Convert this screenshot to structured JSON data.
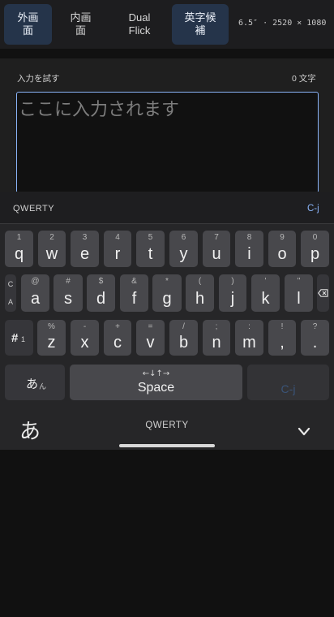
{
  "toolbar": {
    "outer_label": "外画\n面",
    "inner_label": "内画\n面",
    "dual_label": "Dual\nFlick",
    "eng_label": "英字候\n補",
    "device_info": "6.5″ · 2520 × 1080"
  },
  "input": {
    "label": "入力を試す",
    "char_count": "0 文字",
    "placeholder": "ここに入力されます",
    "value": ""
  },
  "keyboard": {
    "layout_name": "QWERTY",
    "mode_label": "C-j",
    "row1": [
      {
        "hint": "1",
        "key": "q"
      },
      {
        "hint": "2",
        "key": "w"
      },
      {
        "hint": "3",
        "key": "e"
      },
      {
        "hint": "4",
        "key": "r"
      },
      {
        "hint": "5",
        "key": "t"
      },
      {
        "hint": "6",
        "key": "y"
      },
      {
        "hint": "7",
        "key": "u"
      },
      {
        "hint": "8",
        "key": "i"
      },
      {
        "hint": "9",
        "key": "o"
      },
      {
        "hint": "0",
        "key": "p"
      }
    ],
    "row2": [
      {
        "hint": "@",
        "key": "a"
      },
      {
        "hint": "#",
        "key": "s"
      },
      {
        "hint": "$",
        "key": "d"
      },
      {
        "hint": "&",
        "key": "f"
      },
      {
        "hint": "*",
        "key": "g"
      },
      {
        "hint": "(",
        "key": "h"
      },
      {
        "hint": ")",
        "key": "j"
      },
      {
        "hint": "'",
        "key": "k"
      },
      {
        "hint": "\"",
        "key": "l"
      }
    ],
    "row3": [
      {
        "hint": "%",
        "key": "z"
      },
      {
        "hint": "-",
        "key": "x"
      },
      {
        "hint": "+",
        "key": "c"
      },
      {
        "hint": "=",
        "key": "v"
      },
      {
        "hint": "/",
        "key": "b"
      },
      {
        "hint": ";",
        "key": "n"
      },
      {
        "hint": ":",
        "key": "m"
      },
      {
        "hint": "!",
        "key": ","
      },
      {
        "hint": "?",
        "key": "."
      }
    ],
    "caps_top": "C",
    "caps_bottom": "A",
    "symbols_label": "#",
    "symbols_sub": "1",
    "kana_label": "あ",
    "kana_sub": "ん",
    "space_arrows": "←↓↑→",
    "space_label": "Space",
    "cj_label": "C-j",
    "lang_glyph": "あ",
    "bottom_layout_name": "QWERTY"
  },
  "colors": {
    "accent": "#8ab4f8",
    "active_tab": "#25344a",
    "key": "#48484c",
    "keyboard_bg": "#262628"
  },
  "icons": {
    "backspace": "backspace-icon",
    "hide_keyboard": "chevron-down-icon"
  }
}
